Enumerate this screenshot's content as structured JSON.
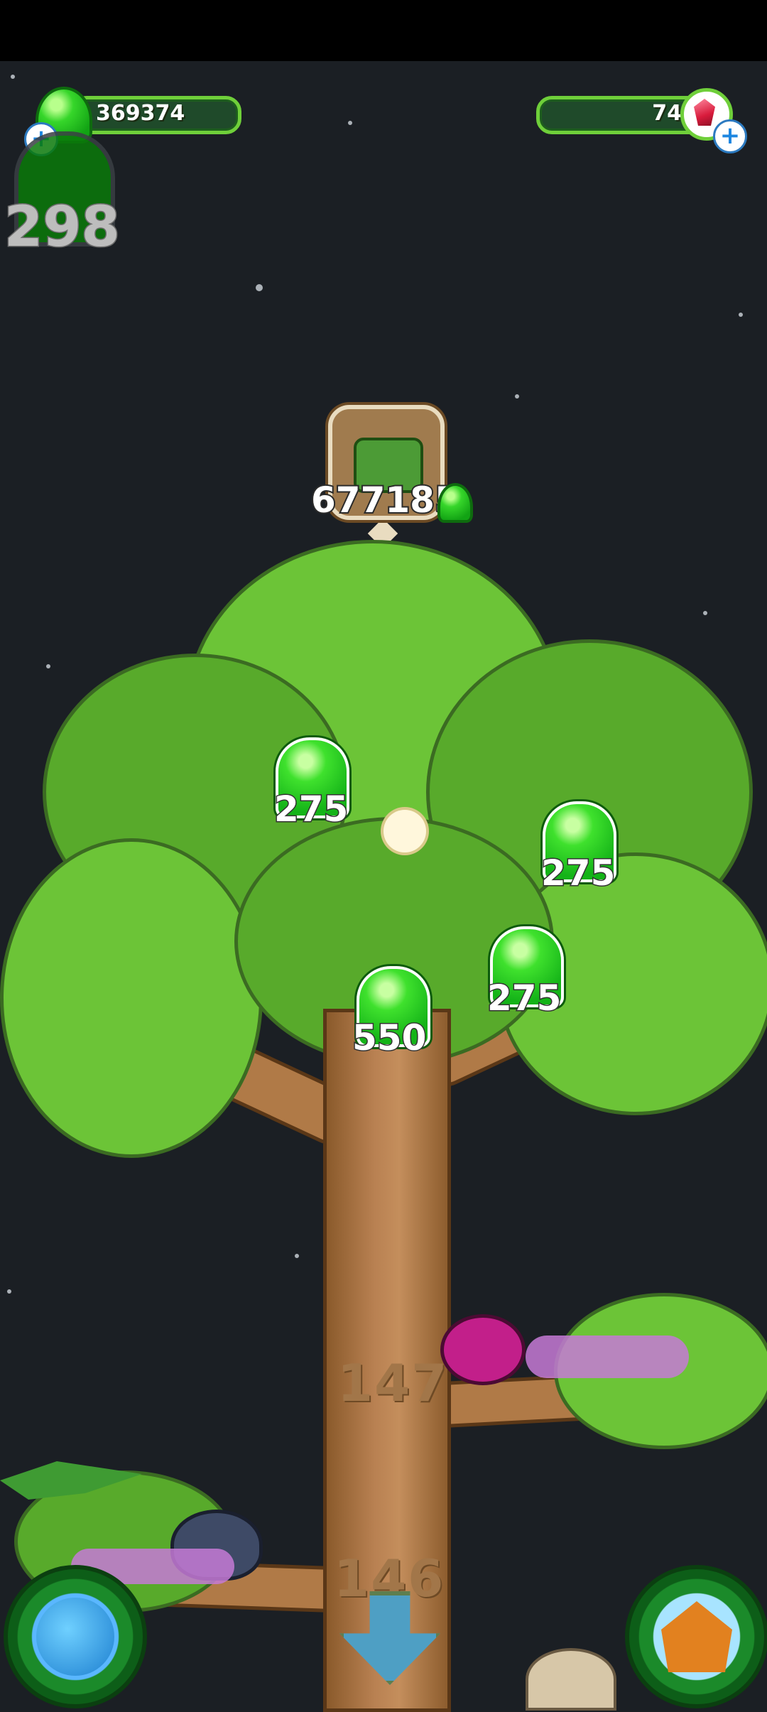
{
  "hud": {
    "gel_amount": "369374",
    "crystal_amount": "74",
    "level_number": "298"
  },
  "tree": {
    "watering_cost": "677185",
    "drops": [
      "275",
      "275",
      "275",
      "550"
    ],
    "carved_numbers": [
      "147",
      "146"
    ]
  },
  "icons": {
    "gel": "green-gel-drop-icon",
    "crystal": "red-crystal-icon",
    "plus": "plus-icon",
    "watering_can": "watering-can-icon",
    "globe": "globe-icon",
    "house": "house-icon",
    "down_arrow": "down-arrow-icon"
  },
  "colors": {
    "background": "#1b1f24",
    "accent_green": "#6fcf3a",
    "leaf": "#6cc437",
    "trunk": "#b98152"
  }
}
